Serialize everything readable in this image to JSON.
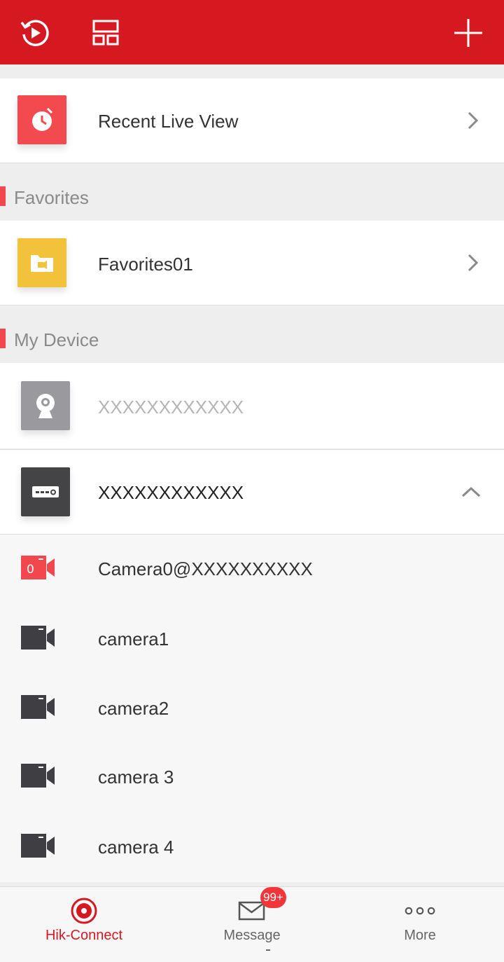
{
  "topbar": {
    "icons": [
      "playback-icon",
      "layout-icon",
      "add-icon"
    ],
    "color": "#d61920"
  },
  "recent": {
    "label": "Recent Live View",
    "icon": "alarm-clock-icon"
  },
  "favorites_section": {
    "title": "Favorites"
  },
  "favorites": [
    {
      "label": "Favorites01",
      "icon": "video-folder-icon"
    }
  ],
  "device_section": {
    "title": "My Device"
  },
  "devices": [
    {
      "label": "XXXXXXXXXXXX",
      "icon": "ip-camera-icon",
      "status": "offline"
    },
    {
      "label": "XXXXXXXXXXXX",
      "icon": "nvr-icon",
      "status": "online",
      "expanded": true
    }
  ],
  "cameras": [
    {
      "label": "Camera0@XXXXXXXXXX",
      "badge": "0",
      "active": true
    },
    {
      "label": "camera1"
    },
    {
      "label": "camera2"
    },
    {
      "label": "camera 3"
    },
    {
      "label": "camera 4"
    }
  ],
  "tabs": [
    {
      "label": "Hik-Connect",
      "icon": "hik-connect-icon",
      "active": true
    },
    {
      "label": "Message",
      "icon": "envelope-icon",
      "badge": "99+"
    },
    {
      "label": "More",
      "icon": "more-dots-icon"
    }
  ],
  "colors": {
    "accent": "#d61920",
    "accent_light": "#f2484d",
    "tile_yellow": "#f2c23a",
    "offline_gray": "#9a9a9e",
    "nvr_dark": "#444447"
  }
}
